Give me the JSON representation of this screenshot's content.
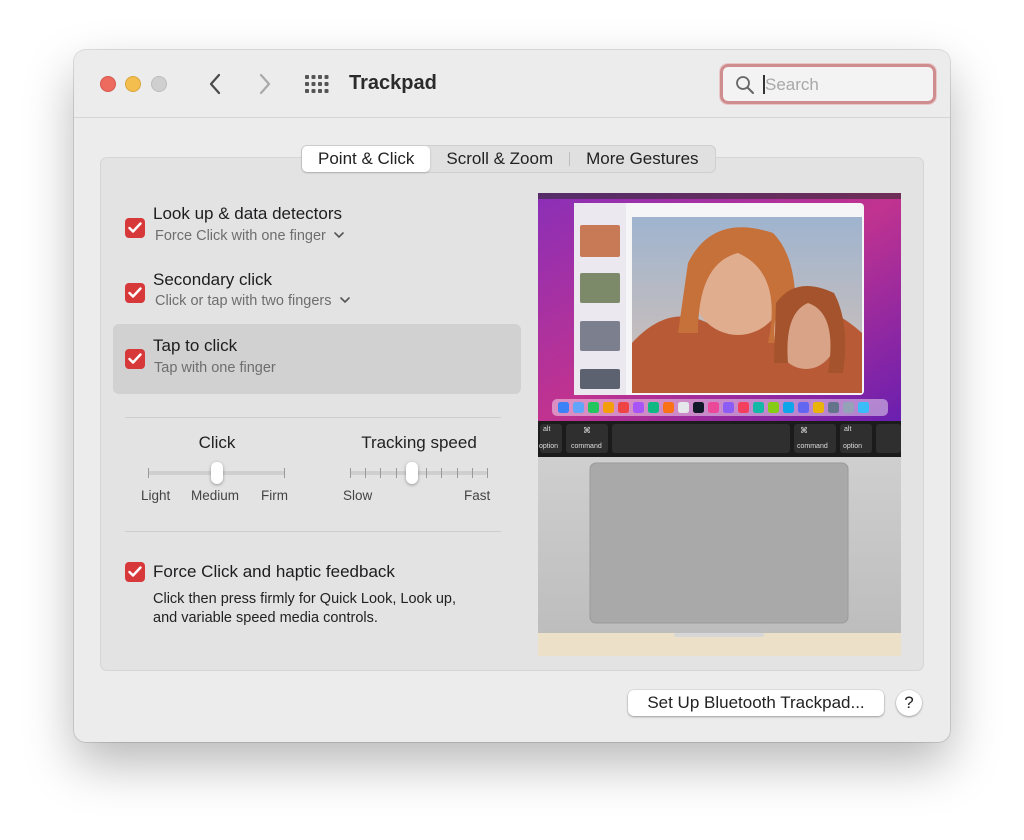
{
  "window": {
    "title": "Trackpad"
  },
  "search": {
    "placeholder": "Search",
    "value": ""
  },
  "tabs": [
    {
      "label": "Point & Click",
      "active": true
    },
    {
      "label": "Scroll & Zoom",
      "active": false
    },
    {
      "label": "More Gestures",
      "active": false
    }
  ],
  "options": {
    "lookup": {
      "title": "Look up & data detectors",
      "subtitle": "Force Click with one finger",
      "checked": true
    },
    "secondary": {
      "title": "Secondary click",
      "subtitle": "Click or tap with two fingers",
      "checked": true
    },
    "tap": {
      "title": "Tap to click",
      "subtitle": "Tap with one finger",
      "checked": true
    },
    "force": {
      "title": "Force Click and haptic feedback",
      "desc_line1": "Click then press firmly for Quick Look, Look up,",
      "desc_line2": "and variable speed media controls.",
      "checked": true
    }
  },
  "sliders": {
    "click": {
      "label": "Click",
      "min_label": "Light",
      "mid_label": "Medium",
      "max_label": "Firm",
      "value": "Medium",
      "level": 0.5
    },
    "tracking": {
      "label": "Tracking speed",
      "min_label": "Slow",
      "max_label": "Fast",
      "level": 0.45
    }
  },
  "preview": {
    "keys": {
      "alt": "alt",
      "option": "option",
      "command": "command",
      "cmd_symbol": "⌘"
    }
  },
  "buttons": {
    "bluetooth": "Set Up Bluetooth Trackpad...",
    "help": "?"
  },
  "colors": {
    "checkbox": "#d7393a",
    "close": "#ed6a5e",
    "minimize": "#f4be4f"
  }
}
